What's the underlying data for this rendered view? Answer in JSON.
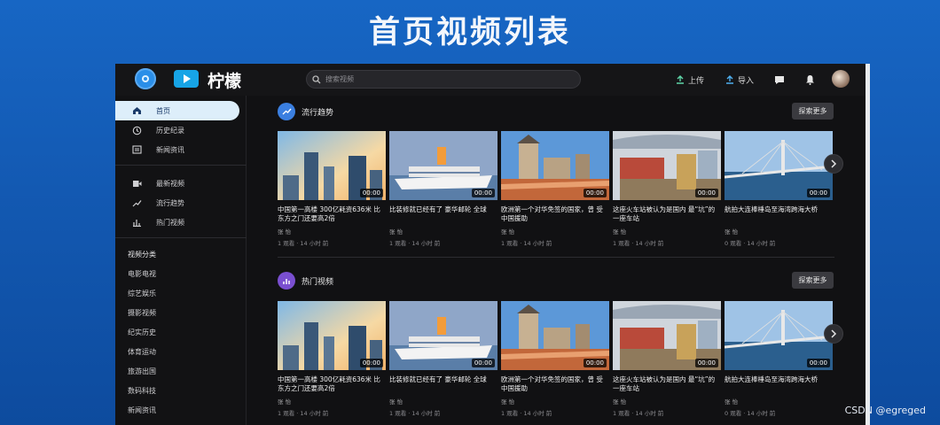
{
  "slide_title": "首页视频列表",
  "app": {
    "brand": "柠檬",
    "search_placeholder": "搜索视频",
    "actions": {
      "upload": "上传",
      "import": "导入"
    },
    "icons": [
      "lemon-badge-icon",
      "play-logo-icon",
      "search-icon",
      "upload-icon",
      "import-icon",
      "message-icon",
      "bell-icon"
    ]
  },
  "sidebar": {
    "main_nav": [
      {
        "label": "首页",
        "icon": "home-icon",
        "active": true
      },
      {
        "label": "历史纪录",
        "icon": "history-icon",
        "active": false
      },
      {
        "label": "新闻资讯",
        "icon": "news-icon",
        "active": false
      }
    ],
    "video_nav": [
      {
        "label": "最新视频",
        "icon": "video-icon"
      },
      {
        "label": "流行趋势",
        "icon": "trend-icon"
      },
      {
        "label": "热门视频",
        "icon": "chart-icon"
      }
    ],
    "category_title": "视频分类",
    "categories": [
      "电影电视",
      "综艺娱乐",
      "摄影视频",
      "纪实历史",
      "体育运动",
      "旅游出国",
      "数码科技",
      "新闻资讯"
    ]
  },
  "sections": [
    {
      "title": "流行趋势",
      "more": "探索更多",
      "accent": "#3b7fe0",
      "videos": [
        {
          "title": "中国第一高楼 300亿耗资636米 比东方之门还要高2倍",
          "author": "张 怡",
          "meta": "1 观看 · 14 小时 前",
          "duration": "00:00"
        },
        {
          "title": "比装修就已经有了 豪华邮轮 全球",
          "author": "张 怡",
          "meta": "1 观看 · 14 小时 前",
          "duration": "00:00"
        },
        {
          "title": "欧洲第一个对华免签的国家，曾 受中国援助",
          "author": "张 怡",
          "meta": "1 观看 · 14 小时 前",
          "duration": "00:00"
        },
        {
          "title": "这座火车站被认为是国内 最“坑”的一座车站",
          "author": "张 怡",
          "meta": "1 观看 · 14 小时 前",
          "duration": "00:00"
        },
        {
          "title": "航拍大连棒棰岛至海湾跨海大桥",
          "author": "张 怡",
          "meta": "0 观看 · 14 小时 前",
          "duration": "00:00"
        }
      ]
    },
    {
      "title": "热门视频",
      "more": "探索更多",
      "accent": "#7a4fd0",
      "videos": [
        {
          "title": "中国第一高楼 300亿耗资636米 比东方之门还要高2倍",
          "author": "张 怡",
          "meta": "1 观看 · 14 小时 前",
          "duration": "00:00"
        },
        {
          "title": "比装修就已经有了 豪华邮轮 全球",
          "author": "张 怡",
          "meta": "1 观看 · 14 小时 前",
          "duration": "00:00"
        },
        {
          "title": "欧洲第一个对华免签的国家，曾 受中国援助",
          "author": "张 怡",
          "meta": "1 观看 · 14 小时 前",
          "duration": "00:00"
        },
        {
          "title": "这座火车站被认为是国内 最“坑”的一座车站",
          "author": "张 怡",
          "meta": "1 观看 · 14 小时 前",
          "duration": "00:00"
        },
        {
          "title": "航拍大连棒棰岛至海湾跨海大桥",
          "author": "张 怡",
          "meta": "0 观看 · 14 小时 前",
          "duration": "00:00"
        }
      ]
    }
  ],
  "watermark": "CSDN @egreged"
}
